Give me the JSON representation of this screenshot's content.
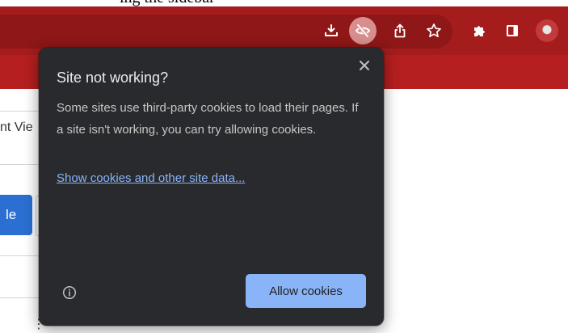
{
  "browser": {
    "toolbar_icons": [
      {
        "name": "download-icon"
      },
      {
        "name": "eye-slash-icon",
        "active": true
      },
      {
        "name": "share-icon"
      },
      {
        "name": "star-icon"
      },
      {
        "name": "puzzle-icon"
      },
      {
        "name": "side-panel-icon"
      },
      {
        "name": "profile-avatar"
      }
    ],
    "colors": {
      "toolbar": "#a51c1c",
      "omnibox": "#8f1717",
      "active_icon_bg": "#d98e8e"
    }
  },
  "background_page": {
    "top_text": "ing the sidebar",
    "fragment_text": "nt Vie",
    "fragment_button": "le",
    "fragment_dots": "⋮"
  },
  "popup": {
    "title": "Site not working?",
    "body": "Some sites use third-party cookies to load their pages. If a site isn't working, you can try allowing cookies.",
    "link": "Show cookies and other site data...",
    "primary_button": "Allow cookies",
    "colors": {
      "background": "#292a2d",
      "button": "#8ab4f8",
      "link": "#8ab4f8"
    }
  }
}
